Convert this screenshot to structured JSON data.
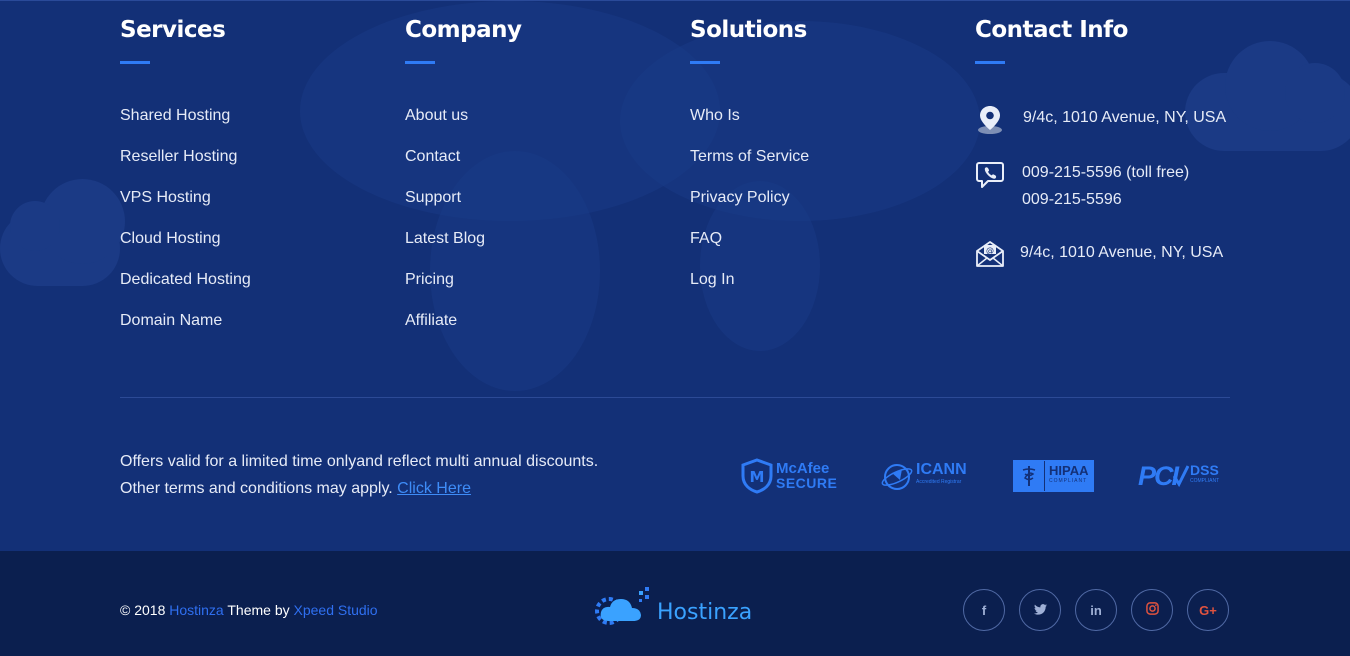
{
  "services": {
    "title": "Services",
    "items": [
      "Shared Hosting",
      "Reseller Hosting",
      "VPS Hosting",
      "Cloud Hosting",
      "Dedicated Hosting",
      "Domain Name"
    ]
  },
  "company": {
    "title": "Company",
    "items": [
      "About us",
      "Contact",
      "Support",
      "Latest Blog",
      "Pricing",
      "Affiliate"
    ]
  },
  "solutions": {
    "title": "Solutions",
    "items": [
      "Who Is",
      "Terms of Service",
      "Privacy Policy",
      "FAQ",
      "Log In"
    ]
  },
  "contact": {
    "title": "Contact Info",
    "address": "9/4c, 1010 Avenue, NY, USA",
    "phone1": "009-215-5596 (toll free)",
    "phone2": "009-215-5596",
    "email": "9/4c, 1010 Avenue, NY, USA",
    "icons": [
      "map-pin-icon",
      "viber-phone-icon",
      "envelope-icon"
    ]
  },
  "offer": {
    "line1": "Offers valid for a limited time onlyand reflect multi annual discounts.",
    "line2": "Other terms and conditions may apply.",
    "link": "Click Here"
  },
  "badges": {
    "mcafee_1": "McAfee",
    "mcafee_2": "SECURE",
    "icann": "ICANN",
    "icann_sub": "Accredited Registrar",
    "hipaa": "HIPAA",
    "hipaa_sub": "COMPLIANT",
    "pci": "PCI",
    "dss": "DSS",
    "dss_sub": "COMPLIANT"
  },
  "bottom": {
    "copyright_prefix": "© 2018",
    "brand_link": "Hostinza",
    "theme_by": "Theme by",
    "studio_link": "Xpeed Studio",
    "logo_text": "Hostinza",
    "socials": [
      {
        "glyph": "f",
        "icon": "facebook-icon"
      },
      {
        "glyph": "t",
        "icon": "twitter-icon"
      },
      {
        "glyph": "in",
        "icon": "linkedin-icon"
      },
      {
        "glyph": "◎",
        "icon": "instagram-icon"
      },
      {
        "glyph": "G+",
        "icon": "google-plus-icon"
      }
    ]
  },
  "colors": {
    "footer_bg": "#133077",
    "bottom_bg": "#0b1f4f",
    "accent": "#2f7bf5",
    "google_plus": "#e0533f"
  }
}
